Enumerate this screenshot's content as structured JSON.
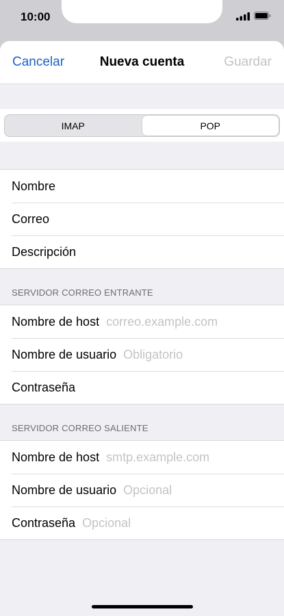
{
  "status_bar": {
    "time": "10:00",
    "signal_icon": "cellular-signal-icon",
    "battery_icon": "battery-icon"
  },
  "nav": {
    "cancel_label": "Cancelar",
    "title": "Nueva cuenta",
    "save_label": "Guardar"
  },
  "segments": {
    "imap_label": "IMAP",
    "pop_label": "POP",
    "selected": "POP"
  },
  "account": {
    "name_label": "Nombre",
    "email_label": "Correo",
    "description_label": "Descripción"
  },
  "incoming": {
    "header": "SERVIDOR CORREO ENTRANTE",
    "host_label": "Nombre de host",
    "host_placeholder": "correo.example.com",
    "user_label": "Nombre de usuario",
    "user_placeholder": "Obligatorio",
    "password_label": "Contraseña"
  },
  "outgoing": {
    "header": "SERVIDOR CORREO SALIENTE",
    "host_label": "Nombre de host",
    "host_placeholder": "smtp.example.com",
    "user_label": "Nombre de usuario",
    "user_placeholder": "Opcional",
    "password_label": "Contraseña",
    "password_placeholder": "Opcional"
  },
  "colors": {
    "accent": "#1b63c6",
    "disabled": "#c3c3c7",
    "placeholder": "#c4c4c8",
    "grouped_background": "#efeff4"
  }
}
